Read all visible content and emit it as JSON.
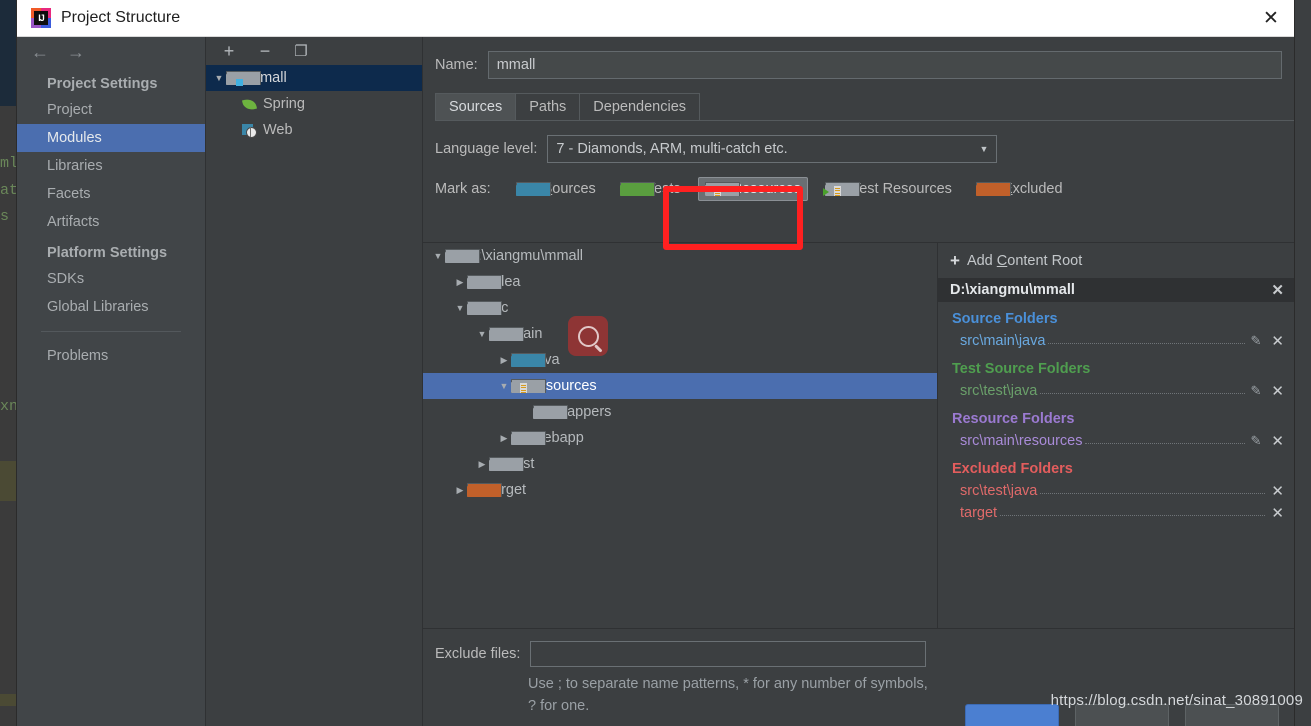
{
  "window": {
    "title": "Project Structure",
    "app_icon": "intellij-idea-icon",
    "close_label": "✕"
  },
  "sidebar": {
    "nav": {
      "back": "←",
      "forward": "→"
    },
    "groups": [
      {
        "label": "Project Settings",
        "items": [
          {
            "label": "Project",
            "selected": false
          },
          {
            "label": "Modules",
            "selected": true
          },
          {
            "label": "Libraries",
            "selected": false
          },
          {
            "label": "Facets",
            "selected": false
          },
          {
            "label": "Artifacts",
            "selected": false
          }
        ]
      },
      {
        "label": "Platform Settings",
        "items": [
          {
            "label": "SDKs",
            "selected": false
          },
          {
            "label": "Global Libraries",
            "selected": false
          }
        ]
      }
    ],
    "problems": {
      "label": "Problems"
    }
  },
  "modules": {
    "toolbar": [
      {
        "name": "add-module-button",
        "glyph": "+"
      },
      {
        "name": "remove-module-button",
        "glyph": "−"
      },
      {
        "name": "copy-module-button",
        "glyph": "❐"
      }
    ],
    "tree": [
      {
        "label": "mmall",
        "icon": "module-folder-icon",
        "expanded": true,
        "selected": true,
        "depth": 0
      },
      {
        "label": "Spring",
        "icon": "spring-leaf-icon",
        "selected": false,
        "depth": 1
      },
      {
        "label": "Web",
        "icon": "web-facet-icon",
        "selected": false,
        "depth": 1
      }
    ]
  },
  "main": {
    "name_label": "Name:",
    "name_value": "mmall",
    "tabs": [
      {
        "label": "Sources",
        "active": true
      },
      {
        "label": "Paths",
        "active": false
      },
      {
        "label": "Dependencies",
        "active": false
      }
    ],
    "language_level_label": "Language level:",
    "language_level_value": "7 - Diamonds, ARM, multi-catch etc.",
    "mark_as_label": "Mark as:",
    "mark_as_buttons": [
      {
        "label": "Sources",
        "mnemonic": "S",
        "rest": "ources",
        "color": "#3a86a8",
        "active": false,
        "icon": "sources-folder-icon"
      },
      {
        "label": "Tests",
        "mnemonic": "T",
        "rest": "ests",
        "color": "#5a9e3f",
        "active": false,
        "icon": "tests-folder-icon"
      },
      {
        "label": "Resources",
        "mnemonic": "R",
        "rest": "esources",
        "color": "#9aa0a6",
        "active": true,
        "icon": "resources-folder-icon"
      },
      {
        "label": "Test Resources",
        "mnemonic": "",
        "rest": "Test Resources",
        "color": "#9aa0a6",
        "active": false,
        "icon": "test-resources-folder-icon"
      },
      {
        "label": "Excluded",
        "mnemonic": "E",
        "rest": "xcluded",
        "color": "#c1602a",
        "active": false,
        "icon": "excluded-folder-icon"
      }
    ]
  },
  "file_tree": [
    {
      "label": "D:\\xiangmu\\mmall",
      "depth": 0,
      "arrow": "down",
      "icon": "grey",
      "selected": false
    },
    {
      "label": ".idea",
      "depth": 1,
      "arrow": "right",
      "icon": "grey",
      "selected": false
    },
    {
      "label": "src",
      "depth": 1,
      "arrow": "down",
      "icon": "grey",
      "selected": false
    },
    {
      "label": "main",
      "depth": 2,
      "arrow": "down",
      "icon": "grey",
      "selected": false
    },
    {
      "label": "java",
      "depth": 3,
      "arrow": "right",
      "icon": "blue",
      "selected": false
    },
    {
      "label": "resources",
      "depth": 3,
      "arrow": "down",
      "icon": "res",
      "selected": true
    },
    {
      "label": "mappers",
      "depth": 4,
      "arrow": "none",
      "icon": "grey",
      "selected": false
    },
    {
      "label": "webapp",
      "depth": 3,
      "arrow": "right",
      "icon": "grey",
      "selected": false
    },
    {
      "label": "test",
      "depth": 2,
      "arrow": "right",
      "icon": "grey",
      "selected": false
    },
    {
      "label": "target",
      "depth": 1,
      "arrow": "right",
      "icon": "orange",
      "selected": false
    }
  ],
  "content_roots": {
    "add_label": "Add Content Root",
    "add_mnemonic": "C",
    "root_path": "D:\\xiangmu\\mmall",
    "groups": [
      {
        "title": "Source Folders",
        "kind": "src",
        "color": "#4a90d9",
        "entries": [
          {
            "path": "src\\main\\java",
            "editable": true
          }
        ]
      },
      {
        "title": "Test Source Folders",
        "kind": "test",
        "color": "#4f9e4f",
        "entries": [
          {
            "path": "src\\test\\java",
            "editable": true
          }
        ]
      },
      {
        "title": "Resource Folders",
        "kind": "res",
        "color": "#9b7ad1",
        "entries": [
          {
            "path": "src\\main\\resources",
            "editable": true
          }
        ]
      },
      {
        "title": "Excluded Folders",
        "kind": "exc",
        "color": "#e35d5d",
        "entries": [
          {
            "path": "src\\test\\java",
            "editable": false
          },
          {
            "path": "target",
            "editable": false
          }
        ]
      }
    ]
  },
  "exclude": {
    "label": "Exclude files:",
    "value": "",
    "hint": "Use ; to separate name patterns, * for any number of symbols, ? for one."
  },
  "watermark": "https://blog.csdn.net/sinat_30891009",
  "background_code": [
    "ml",
    "ata",
    "s",
    "xn"
  ],
  "accent_colors": {
    "selection_blue": "#4b6eaf",
    "module_selection": "#0d2a4c",
    "annotation_red": "#ff2020",
    "cursor_red": "#8e3535",
    "ide_accent": "#2f84d2"
  }
}
